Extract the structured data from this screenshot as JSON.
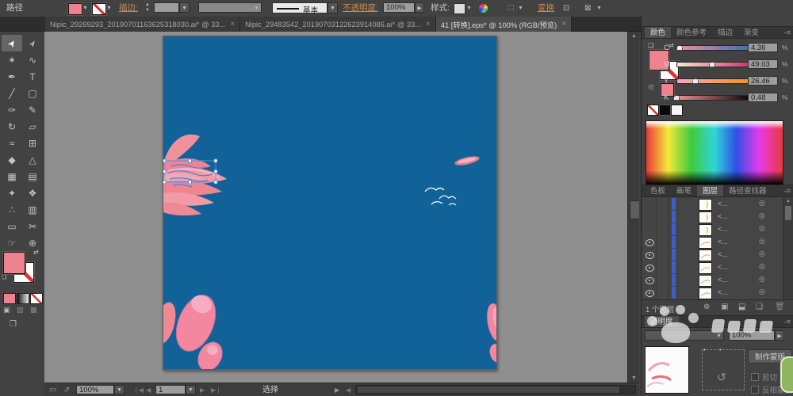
{
  "colors": {
    "fill_pink": "#ee8390",
    "artboard_blue": "#116298",
    "petal": "#ef8a93",
    "petal_light": "#f5aab4",
    "blob_pink": "#f2879f",
    "blob_highlight": "#f7adc0",
    "accent_orange": "#c98a50",
    "selection_blue": "#4f7fd9",
    "layer_bar_blue": "#3a5fc8",
    "thumb_yellow": "#f0b440"
  },
  "icons": {
    "dropdown": "▼",
    "close": "×",
    "menu": "-≡",
    "target": "◎",
    "up_arrow": "▲",
    "down_arrow": "▼",
    "release_arrow": "↺"
  },
  "topbar": {
    "context_label": "路径",
    "stroke_label": "描边:",
    "brush_basic": "基本",
    "opacity_label": "不透明度:",
    "opacity_value": "100%",
    "style_label": "样式:",
    "transform_label": "变换"
  },
  "doc_tabs": [
    {
      "label": "Nipic_29269293_20190701163625318030.ai* @ 33...",
      "close": "×",
      "active": false
    },
    {
      "label": "Nipic_29483542_20190703122623914086.ai* @ 33...",
      "close": "×",
      "active": false
    },
    {
      "label": "41 [转换].eps* @ 100% (RGB/预览)",
      "close": "×",
      "active": true
    }
  ],
  "tools": [
    {
      "name": "selection-tool",
      "glyph": "➤",
      "active": true
    },
    {
      "name": "direct-selection-tool",
      "glyph": "➢",
      "active": false
    },
    {
      "name": "magic-wand-tool",
      "glyph": "✶",
      "active": false
    },
    {
      "name": "lasso-tool",
      "glyph": "∿",
      "active": false
    },
    {
      "name": "pen-tool",
      "glyph": "✒",
      "active": false
    },
    {
      "name": "type-tool",
      "glyph": "T",
      "active": false
    },
    {
      "name": "line-tool",
      "glyph": "╱",
      "active": false
    },
    {
      "name": "rectangle-tool",
      "glyph": "▢",
      "active": false
    },
    {
      "name": "paintbrush-tool",
      "glyph": "✑",
      "active": false
    },
    {
      "name": "pencil-tool",
      "glyph": "✎",
      "active": false
    },
    {
      "name": "rotate-tool",
      "glyph": "↻",
      "active": false
    },
    {
      "name": "scale-tool",
      "glyph": "▱",
      "active": false
    },
    {
      "name": "width-tool",
      "glyph": "≈",
      "active": false
    },
    {
      "name": "free-transform-tool",
      "glyph": "⊞",
      "active": false
    },
    {
      "name": "shape-builder-tool",
      "glyph": "◆",
      "active": false
    },
    {
      "name": "perspective-grid-tool",
      "glyph": "△",
      "active": false
    },
    {
      "name": "mesh-tool",
      "glyph": "▦",
      "active": false
    },
    {
      "name": "gradient-tool",
      "glyph": "▤",
      "active": false
    },
    {
      "name": "eyedropper-tool",
      "glyph": "✦",
      "active": false
    },
    {
      "name": "blend-tool",
      "glyph": "❖",
      "active": false
    },
    {
      "name": "symbol-sprayer-tool",
      "glyph": "∴",
      "active": false
    },
    {
      "name": "column-graph-tool",
      "glyph": "▥",
      "active": false
    },
    {
      "name": "artboard-tool",
      "glyph": "▭",
      "active": false
    },
    {
      "name": "slice-tool",
      "glyph": "✂",
      "active": false
    },
    {
      "name": "hand-tool",
      "glyph": "☞",
      "active": false
    },
    {
      "name": "zoom-tool",
      "glyph": "⊕",
      "active": false
    }
  ],
  "color_panel": {
    "tabs": [
      {
        "label": "颜色",
        "active": true
      },
      {
        "label": "颜色参考",
        "active": false
      },
      {
        "label": "描边",
        "active": false
      },
      {
        "label": "渐变",
        "active": false
      }
    ],
    "sliders": [
      {
        "channel": "C",
        "value": "4.36",
        "percent": 4.36,
        "gradient": [
          "#f09098",
          "#3a6fb0"
        ]
      },
      {
        "channel": "M",
        "value": "49.03",
        "percent": 49.03,
        "gradient": [
          "#f3ecd2",
          "#d5306e"
        ]
      },
      {
        "channel": "Y",
        "value": "26.46",
        "percent": 26.46,
        "gradient": [
          "#f2a9c4",
          "#f0941c"
        ]
      },
      {
        "channel": "K",
        "value": "0.48",
        "percent": 0.48,
        "gradient": [
          "#ef9097",
          "#0a0508"
        ]
      }
    ],
    "percent_sign": "%"
  },
  "panel_tabs2": [
    {
      "label": "色板",
      "active": false
    },
    {
      "label": "画笔",
      "active": false
    },
    {
      "label": "图层",
      "active": true
    },
    {
      "label": "路径查找器",
      "active": false
    }
  ],
  "layers": {
    "rows": [
      {
        "visible": false,
        "thumb": "yellow",
        "label": "<...",
        "target": "◎"
      },
      {
        "visible": false,
        "thumb": "yellow",
        "label": "<...",
        "target": "◎"
      },
      {
        "visible": false,
        "thumb": "yellow",
        "label": "<...",
        "target": "◎"
      },
      {
        "visible": true,
        "thumb": "pink",
        "label": "<...",
        "target": "◎"
      },
      {
        "visible": true,
        "thumb": "pink",
        "label": "<...",
        "target": "◎"
      },
      {
        "visible": true,
        "thumb": "pink",
        "label": "<...",
        "target": "◎"
      },
      {
        "visible": true,
        "thumb": "pink",
        "label": "<...",
        "target": "◎"
      },
      {
        "visible": true,
        "thumb": "pink",
        "label": "<...",
        "target": "◎"
      }
    ],
    "footer_count": "1 个图层"
  },
  "transparency": {
    "title": "透明度",
    "opacity_value": "100%",
    "make_mask_label": "制作蒙版",
    "clip_label": "剪切",
    "invert_label": "反相蒙版"
  },
  "statusbar": {
    "zoom_value": "100%",
    "artboard_value": "1",
    "status_text": "选择"
  }
}
